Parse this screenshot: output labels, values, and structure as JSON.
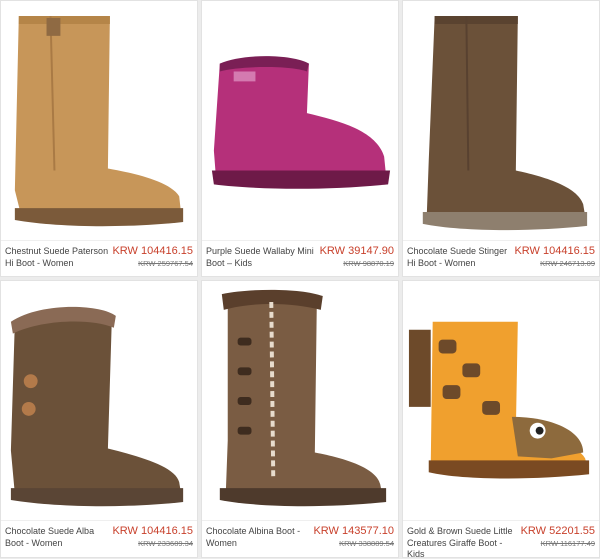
{
  "products": [
    {
      "name": "Chestnut Suede Paterson Hi Boot - Women",
      "price": "KRW 104416.15",
      "old_price": "KRW 259767.54",
      "color": "#c79659"
    },
    {
      "name": "Purple Suede Wallaby Mini Boot – Kids",
      "price": "KRW 39147.90",
      "old_price": "KRW 98870.19",
      "color": "#b5307a"
    },
    {
      "name": "Chocolate Suede Stinger Hi Boot - Women",
      "price": "KRW 104416.15",
      "old_price": "KRW 246713.09",
      "color": "#6b5139"
    },
    {
      "name": "Chocolate Suede Alba Boot - Women",
      "price": "KRW 104416.15",
      "old_price": "KRW 233689.34",
      "color": "#6b5139"
    },
    {
      "name": "Chocolate Albina Boot - Women",
      "price": "KRW 143577.10",
      "old_price": "KRW 338889.54",
      "color": "#7a5c43"
    },
    {
      "name": "Gold & Brown Suede Little Creatures Giraffe Boot - Kids",
      "price": "KRW 52201.55",
      "old_price": "KRW 116177.49",
      "color": "#f0a02e"
    }
  ]
}
